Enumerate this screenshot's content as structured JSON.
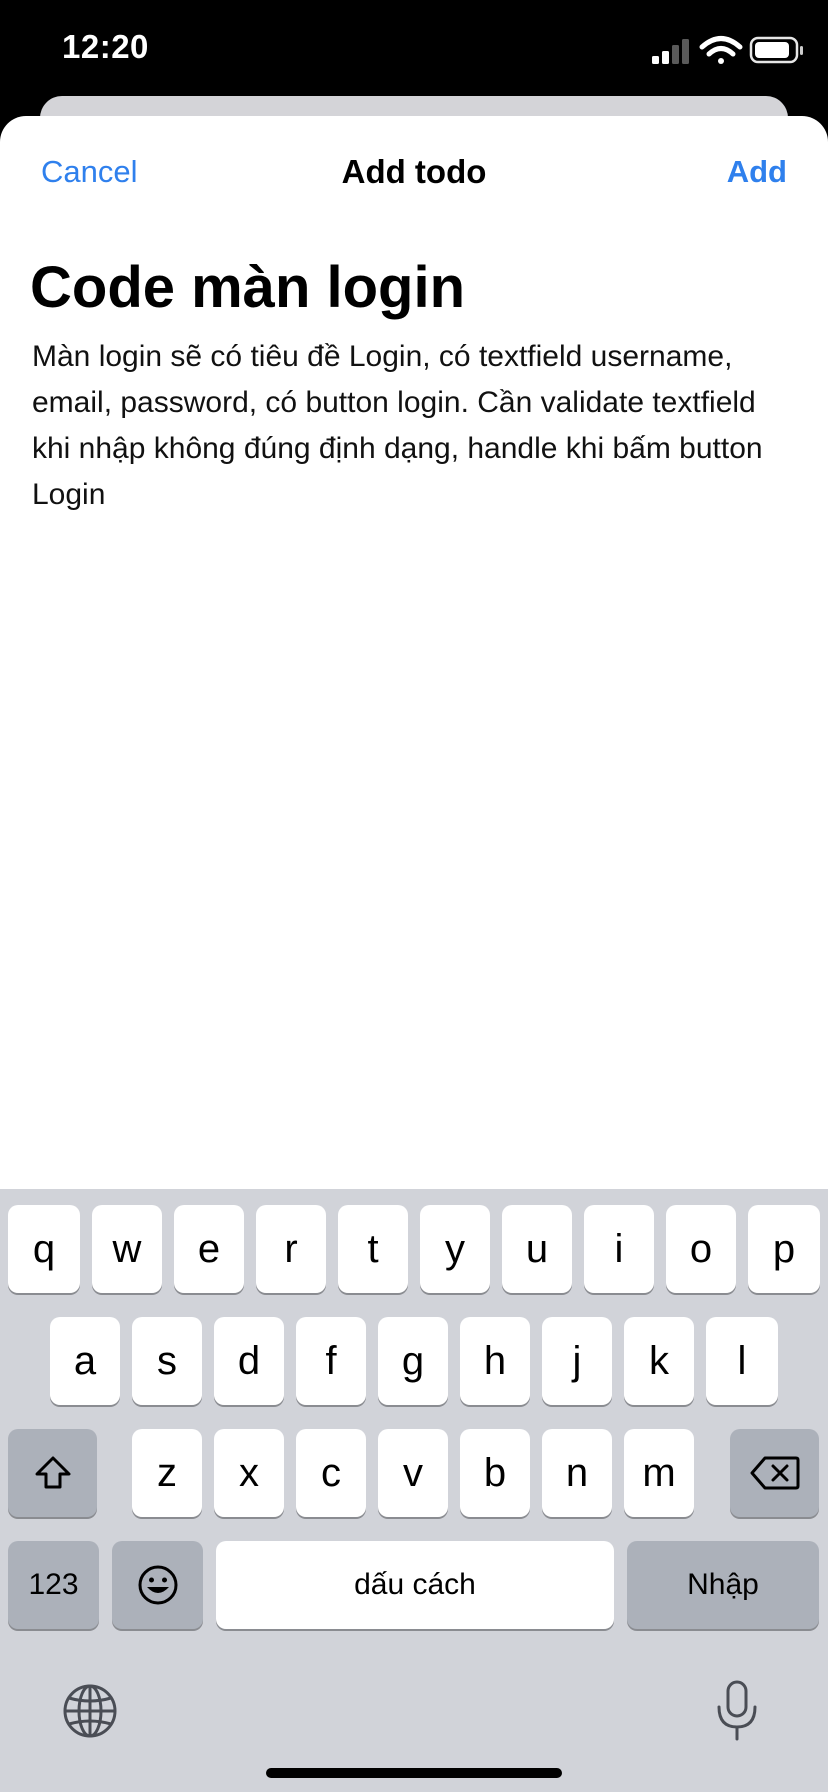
{
  "status": {
    "time": "12:20"
  },
  "nav": {
    "cancel": "Cancel",
    "title": "Add todo",
    "add": "Add"
  },
  "todo": {
    "title": "Code màn login",
    "description": "Màn login sẽ có tiêu đề Login, có textfield username, email, password, có button login. Cần validate textfield khi nhập không đúng định dạng, handle khi bấm button Login"
  },
  "keyboard": {
    "row1": [
      "q",
      "w",
      "e",
      "r",
      "t",
      "y",
      "u",
      "i",
      "o",
      "p"
    ],
    "row2": [
      "a",
      "s",
      "d",
      "f",
      "g",
      "h",
      "j",
      "k",
      "l"
    ],
    "row3": [
      "z",
      "x",
      "c",
      "v",
      "b",
      "n",
      "m"
    ],
    "numbers": "123",
    "space": "dấu cách",
    "return": "Nhập"
  },
  "colors": {
    "accent": "#2f80ed",
    "keyboard_bg": "#d1d3d9",
    "func_key": "#acb1ba"
  },
  "icons": [
    "signal-icon",
    "wifi-icon",
    "battery-icon",
    "shift-icon",
    "delete-icon",
    "emoji-icon",
    "globe-icon",
    "microphone-icon"
  ]
}
